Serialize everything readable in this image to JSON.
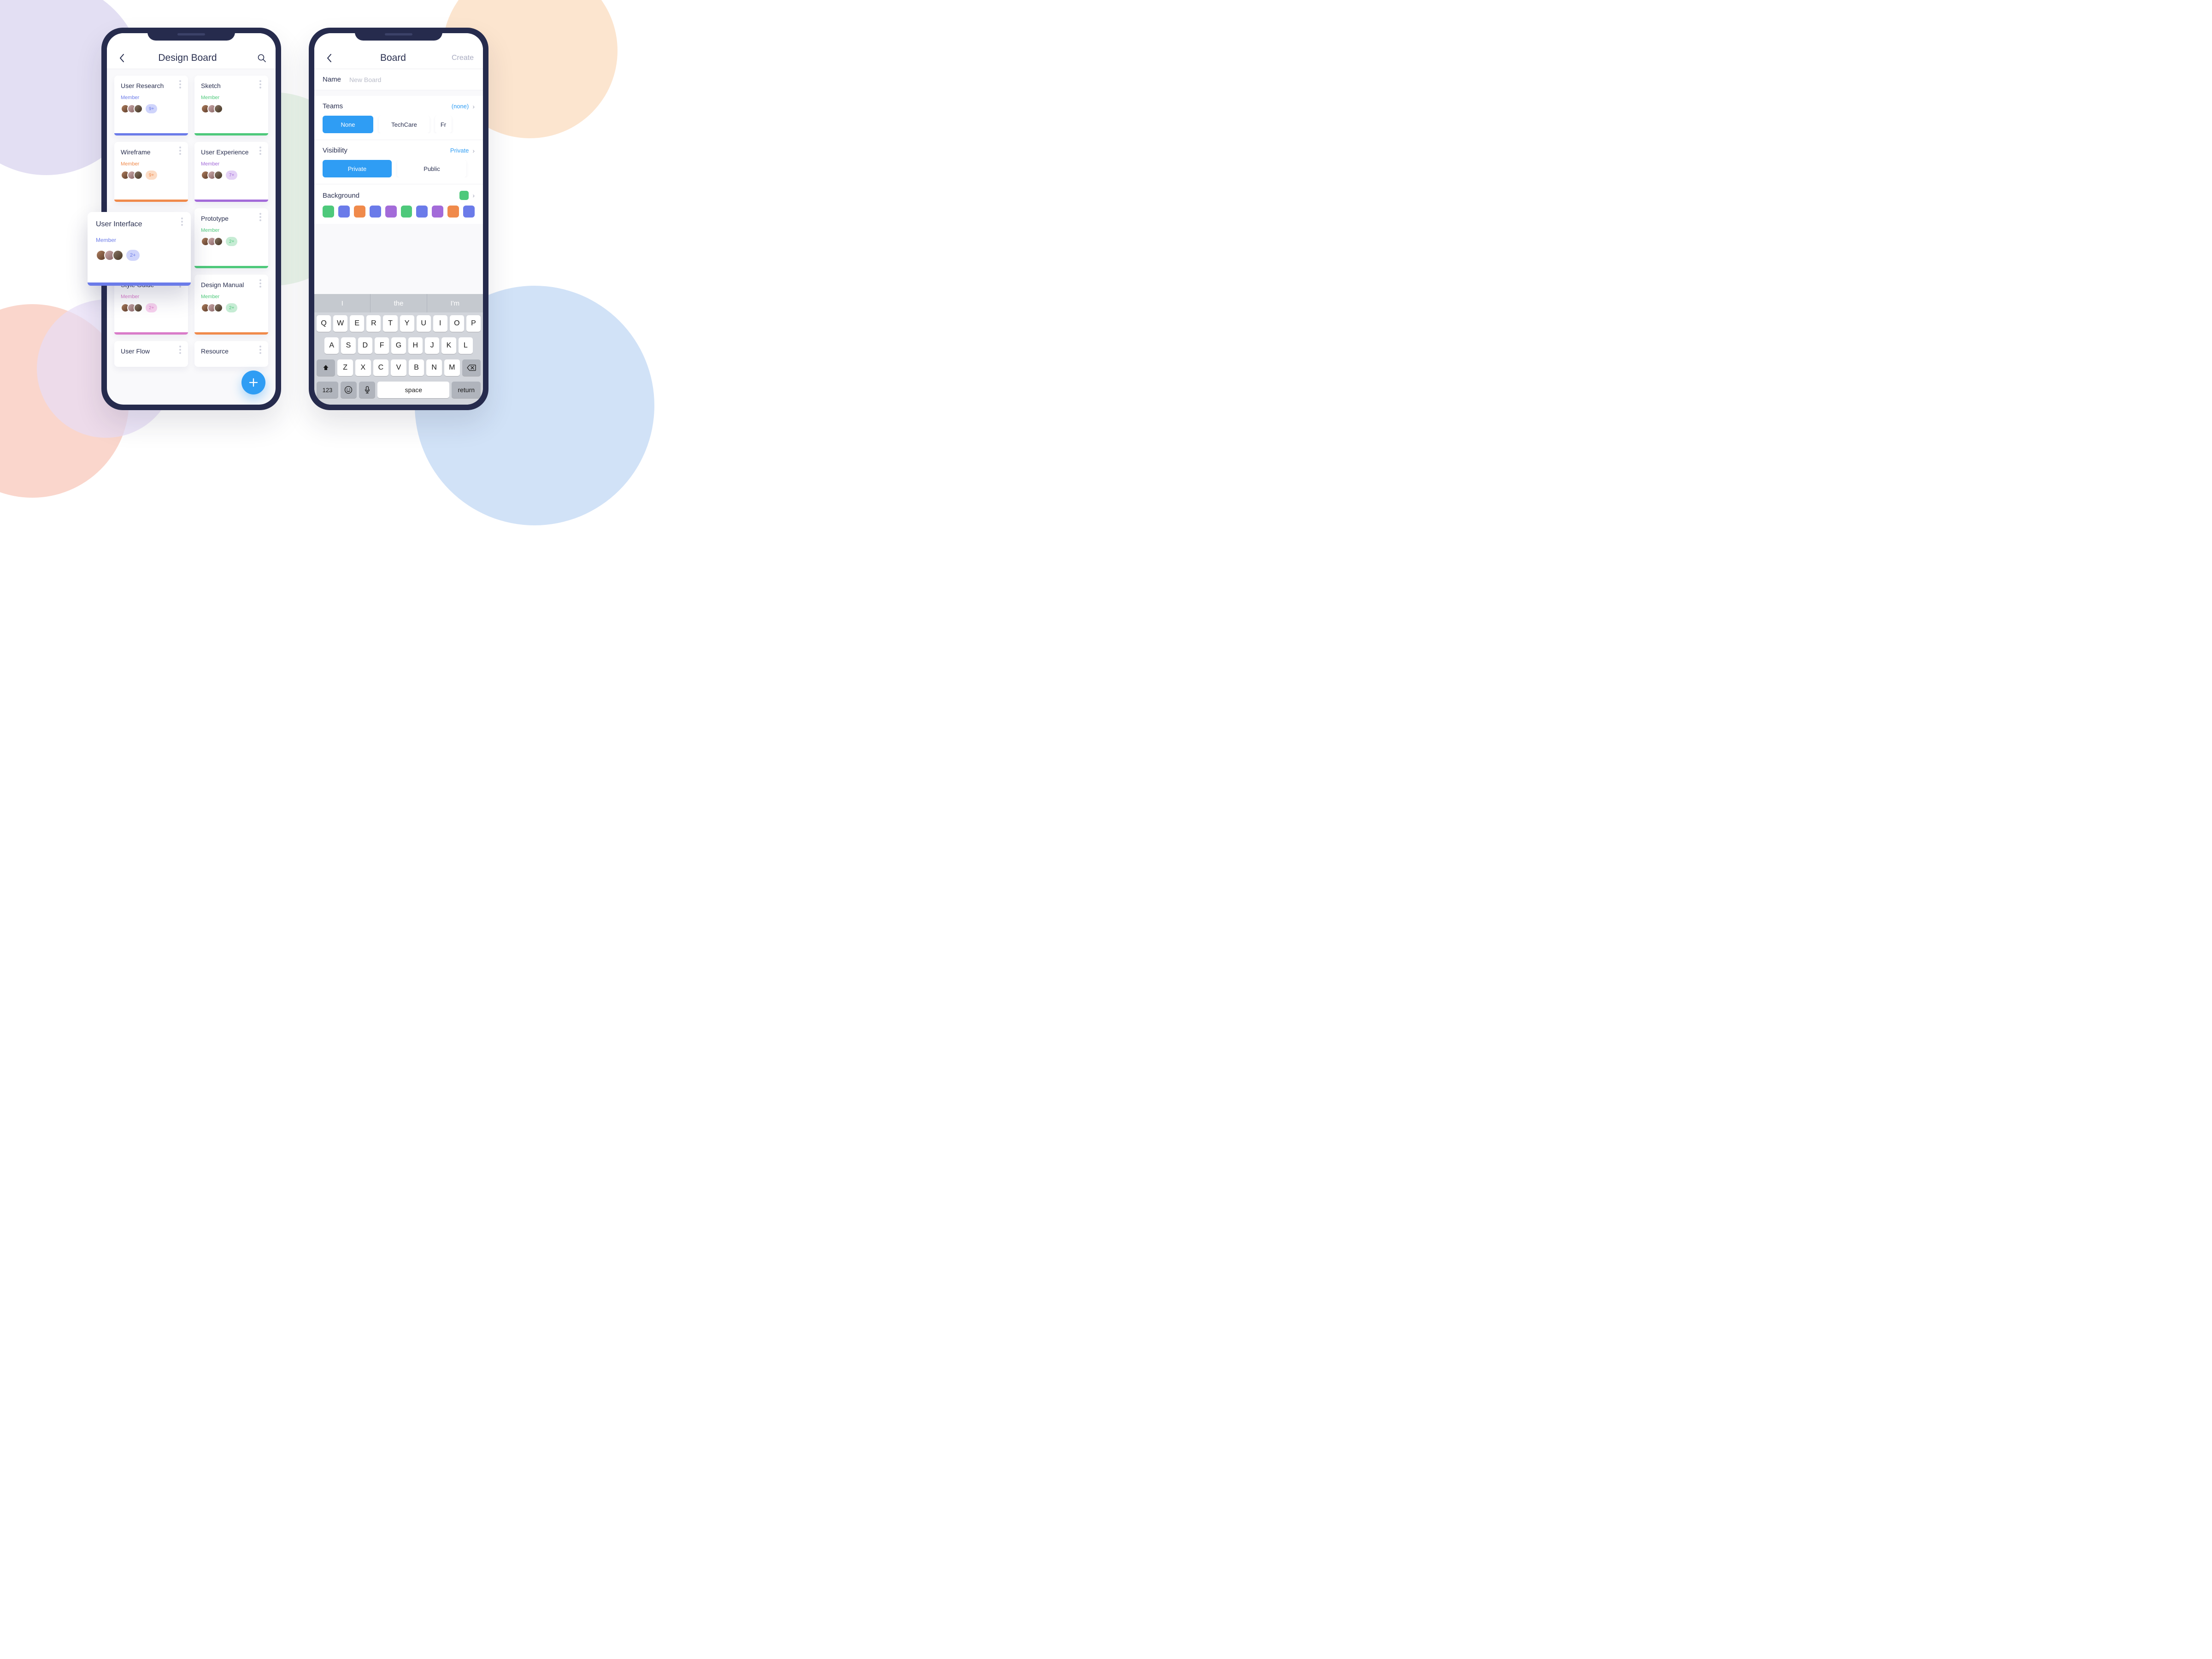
{
  "left": {
    "title": "Design Board",
    "member_label": "Member",
    "cards": [
      {
        "title": "User Research",
        "color": "#6b7be9",
        "sub_color": "#6b7be9",
        "badge": "9+",
        "badge_bg": "#cfd4fb",
        "badge_fg": "#6b7be9"
      },
      {
        "title": "Sketch",
        "color": "#4ec97b",
        "sub_color": "#4ec97b",
        "badge": "",
        "badge_bg": "",
        "badge_fg": ""
      },
      {
        "title": "Wireframe",
        "color": "#f08a4b",
        "sub_color": "#f08a4b",
        "badge": "9+",
        "badge_bg": "#fcdcc5",
        "badge_fg": "#f08a4b"
      },
      {
        "title": "User Experience",
        "color": "#a36bd9",
        "sub_color": "#a36bd9",
        "badge": "7+",
        "badge_bg": "#e4d1f6",
        "badge_fg": "#a36bd9"
      },
      {
        "title": "User Interface",
        "color": "#6b7be9",
        "sub_color": "#6b7be9",
        "badge": "",
        "badge_bg": "",
        "badge_fg": ""
      },
      {
        "title": "Prototype",
        "color": "#4ec97b",
        "sub_color": "#4ec97b",
        "badge": "2+",
        "badge_bg": "#c6ecd4",
        "badge_fg": "#4ec97b"
      },
      {
        "title": "Style Guide",
        "color": "#d97bc9",
        "sub_color": "#d97bc9",
        "badge": "2+",
        "badge_bg": "#f7d1ee",
        "badge_fg": "#d97bc9"
      },
      {
        "title": "Design Manual",
        "color": "#f08a4b",
        "sub_color": "#4ec97b",
        "badge": "2+",
        "badge_bg": "#c6ecd4",
        "badge_fg": "#4ec97b"
      },
      {
        "title": "User Flow",
        "color": "#6b7be9",
        "sub_color": "#6b7be9",
        "badge": "",
        "badge_bg": "",
        "badge_fg": ""
      },
      {
        "title": "Resource",
        "color": "#4ec97b",
        "sub_color": "#4ec97b",
        "badge": "",
        "badge_bg": "",
        "badge_fg": ""
      }
    ],
    "floating": {
      "title": "User Interface",
      "sub": "Member",
      "badge": "2+",
      "color": "#6b7be9"
    }
  },
  "right": {
    "title": "Board",
    "create": "Create",
    "name_label": "Name",
    "name_placeholder": "New Board",
    "teams_label": "Teams",
    "teams_value": "(none)",
    "team_chips": [
      "None",
      "TechCare",
      "Fr"
    ],
    "visibility_label": "Visibility",
    "visibility_value": "Private",
    "visibility_chips": [
      "Private",
      "Public"
    ],
    "background_label": "Background",
    "bg_selected": "#4ec97b",
    "swatches": [
      "#4ec97b",
      "#6b7be9",
      "#f08a4b",
      "#6b7be9",
      "#a36bd9",
      "#4ec97b",
      "#6b7be9",
      "#a36bd9",
      "#f08a4b",
      "#6b7be9"
    ],
    "suggestions": [
      "I",
      "the",
      "I'm"
    ],
    "kbd": {
      "r1": [
        "Q",
        "W",
        "E",
        "R",
        "T",
        "Y",
        "U",
        "I",
        "O",
        "P"
      ],
      "r2": [
        "A",
        "S",
        "D",
        "F",
        "G",
        "H",
        "J",
        "K",
        "L"
      ],
      "r3": [
        "Z",
        "X",
        "C",
        "V",
        "B",
        "N",
        "M"
      ],
      "num": "123",
      "space": "space",
      "return": "return"
    }
  }
}
